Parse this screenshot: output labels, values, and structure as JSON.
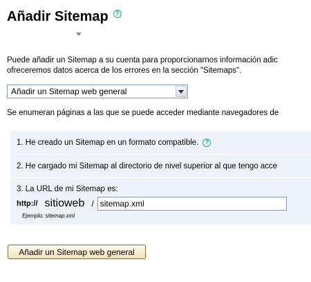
{
  "header": {
    "title": "Añadir Sitemap",
    "help_icon": "?"
  },
  "intro": {
    "line1": "Puede añadir un Sitemap a su cuenta para proporcionarnos información adic",
    "line2": "ofreceremos datos acerca de los errores en la sección \"Sitemaps\"."
  },
  "sitemap_type": {
    "selected": "Añadir un Sitemap web general"
  },
  "description": "Se enumeran páginas a las que se puede acceder mediante navegadores de",
  "steps": {
    "step1": "1. He creado un Sitemap en un formato compatible.",
    "step2": "2. He cargado mi Sitemap al directorio de nivel superior al que tengo acce",
    "step3": "3. La URL de mi Sitemap es:"
  },
  "url": {
    "prefix": "http://",
    "host": "sitioweb",
    "slash": "/",
    "value": "sitemap.xml",
    "example": "Ejemplo: sitemap.xml"
  },
  "submit_label": "Añadir un Sitemap web general",
  "colors": {
    "help_icon": "#2ea6a6",
    "steps_background": "#eef3fb",
    "button_border": "#8a6a1b"
  }
}
